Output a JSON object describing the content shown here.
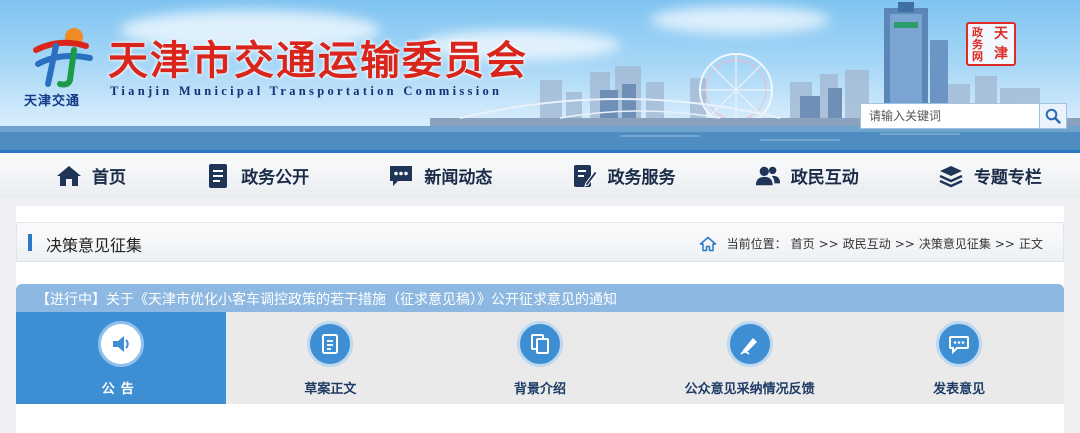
{
  "header": {
    "logo_caption": "天津交通",
    "title_cn": "天津市交通运输委员会",
    "title_en": "Tianjin Municipal Transportation Commission",
    "seal_chars": [
      "天",
      "津",
      "政",
      "务",
      "网"
    ],
    "search_placeholder": "请输入关键词"
  },
  "nav": {
    "items": [
      {
        "label": "首页",
        "icon": "home-icon"
      },
      {
        "label": "政务公开",
        "icon": "document-icon"
      },
      {
        "label": "新闻动态",
        "icon": "chat-bubble-icon"
      },
      {
        "label": "政务服务",
        "icon": "form-edit-icon"
      },
      {
        "label": "政民互动",
        "icon": "users-icon"
      },
      {
        "label": "专题专栏",
        "icon": "layers-icon"
      }
    ]
  },
  "section": {
    "title": "决策意见征集",
    "breadcrumb_prefix": "当前位置：",
    "breadcrumb": [
      "首页",
      "政民互动",
      "决策意见征集",
      "正文"
    ],
    "separator": ">>"
  },
  "notice": {
    "text": "【进行中】关于《天津市优化小客车调控政策的若干措施（征求意见稿）》公开征求意见的通知"
  },
  "tabs": [
    {
      "label": "公告",
      "icon": "speaker-icon",
      "active": true
    },
    {
      "label": "草案正文",
      "icon": "draft-document-icon",
      "active": false
    },
    {
      "label": "背景介绍",
      "icon": "copy-pages-icon",
      "active": false
    },
    {
      "label": "公众意见采纳情况反馈",
      "icon": "pen-feedback-icon",
      "active": false
    },
    {
      "label": "发表意见",
      "icon": "comment-icon",
      "active": false
    }
  ],
  "colors": {
    "brand_red": "#d9251c",
    "brand_blue": "#2b78c5",
    "tab_active": "#3e8ed4",
    "notice_bar": "#8cb8e1"
  }
}
